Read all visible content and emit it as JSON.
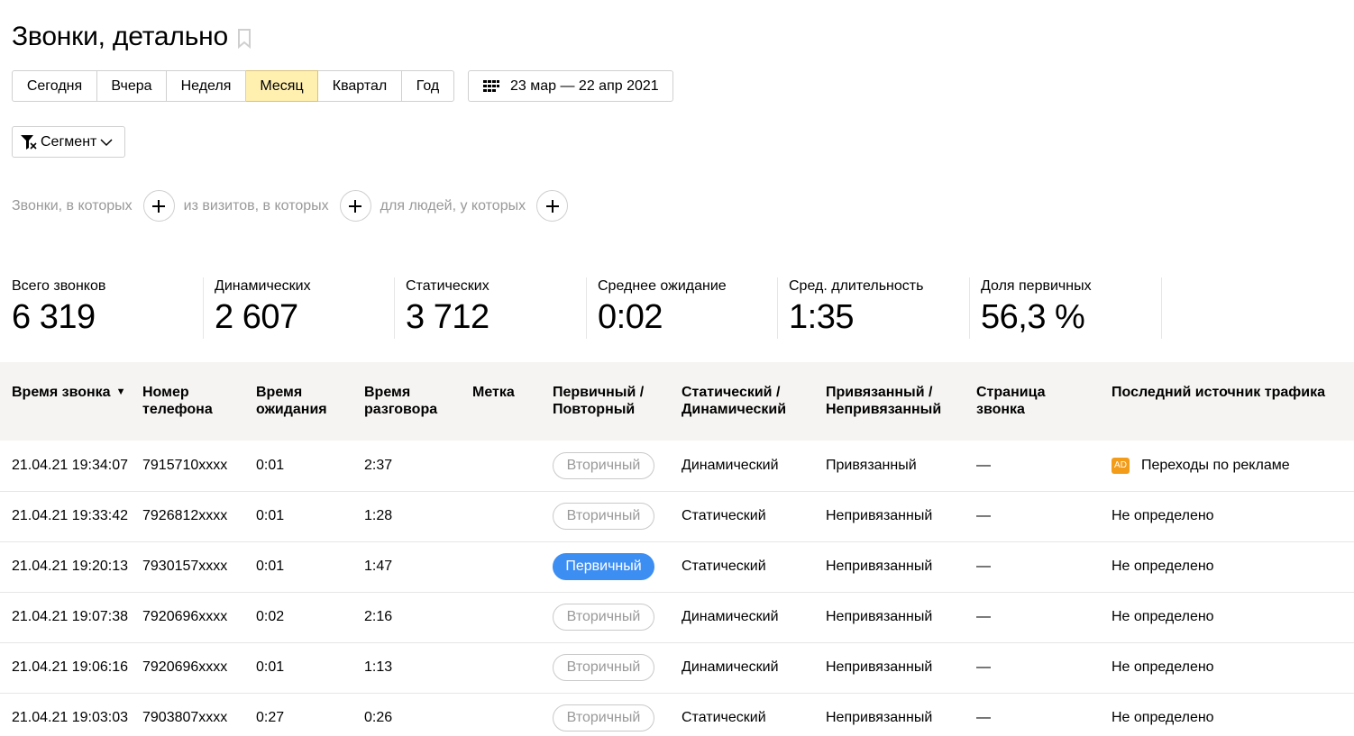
{
  "page": {
    "title": "Звонки, детально"
  },
  "periods": [
    {
      "label": "Сегодня",
      "active": false
    },
    {
      "label": "Вчера",
      "active": false
    },
    {
      "label": "Неделя",
      "active": false
    },
    {
      "label": "Месяц",
      "active": true
    },
    {
      "label": "Квартал",
      "active": false
    },
    {
      "label": "Год",
      "active": false
    }
  ],
  "date_range": {
    "label": "23 мар — 22 апр 2021",
    "icon": "calendar-grid-icon"
  },
  "segment": {
    "label": "Сегмент",
    "icon": "funnel-icon"
  },
  "filters": {
    "calls_label": "Звонки, в которых",
    "visits_label": "из визитов, в которых",
    "people_label": "для людей, у которых"
  },
  "stats": [
    {
      "label": "Всего звонков",
      "value": "6 319"
    },
    {
      "label": "Динамических",
      "value": "2 607"
    },
    {
      "label": "Статических",
      "value": "3 712"
    },
    {
      "label": "Среднее ожидание",
      "value": "0:02"
    },
    {
      "label": "Сред. длительность",
      "value": "1:35"
    },
    {
      "label": "Доля первичных",
      "value": "56,3 %"
    }
  ],
  "table": {
    "headers": {
      "time": [
        "Время звонка",
        ""
      ],
      "time_sort": "▼",
      "phone": [
        "Номер",
        "телефона"
      ],
      "wait": [
        "Время",
        "ожидания"
      ],
      "talk": [
        "Время",
        "разговора"
      ],
      "tag": [
        "Метка",
        ""
      ],
      "primary": [
        "Первичный /",
        "Повторный"
      ],
      "static": [
        "Статический /",
        "Динамический"
      ],
      "bound": [
        "Привязанный /",
        "Непривязанный"
      ],
      "page": [
        "Страница",
        "звонка"
      ],
      "source": [
        "Последний источник трафика",
        ""
      ]
    },
    "rows": [
      {
        "time": "21.04.21 19:34:07",
        "phone": "7915710xxxx",
        "wait": "0:01",
        "talk": "2:37",
        "tag": "",
        "type": "Вторичный",
        "type_primary": false,
        "static": "Динамический",
        "bound": "Привязанный",
        "page": "—",
        "source": "Переходы по рекламе",
        "source_badge": "AD"
      },
      {
        "time": "21.04.21 19:33:42",
        "phone": "7926812xxxx",
        "wait": "0:01",
        "talk": "1:28",
        "tag": "",
        "type": "Вторичный",
        "type_primary": false,
        "static": "Статический",
        "bound": "Непривязанный",
        "page": "—",
        "source": "Не определено",
        "source_badge": ""
      },
      {
        "time": "21.04.21 19:20:13",
        "phone": "7930157xxxx",
        "wait": "0:01",
        "talk": "1:47",
        "tag": "",
        "type": "Первичный",
        "type_primary": true,
        "static": "Статический",
        "bound": "Непривязанный",
        "page": "—",
        "source": "Не определено",
        "source_badge": ""
      },
      {
        "time": "21.04.21 19:07:38",
        "phone": "7920696xxxx",
        "wait": "0:02",
        "talk": "2:16",
        "tag": "",
        "type": "Вторичный",
        "type_primary": false,
        "static": "Динамический",
        "bound": "Непривязанный",
        "page": "—",
        "source": "Не определено",
        "source_badge": ""
      },
      {
        "time": "21.04.21 19:06:16",
        "phone": "7920696xxxx",
        "wait": "0:01",
        "talk": "1:13",
        "tag": "",
        "type": "Вторичный",
        "type_primary": false,
        "static": "Динамический",
        "bound": "Непривязанный",
        "page": "—",
        "source": "Не определено",
        "source_badge": ""
      },
      {
        "time": "21.04.21 19:03:03",
        "phone": "7903807xxxx",
        "wait": "0:27",
        "talk": "0:26",
        "tag": "",
        "type": "Вторичный",
        "type_primary": false,
        "static": "Статический",
        "bound": "Непривязанный",
        "page": "—",
        "source": "Не определено",
        "source_badge": ""
      }
    ]
  },
  "colors": {
    "active_period": "#fff0b0",
    "primary_pill": "#3d8ef2",
    "ad_badge": "#f39c1a",
    "header_bg": "#f5f4f2"
  }
}
